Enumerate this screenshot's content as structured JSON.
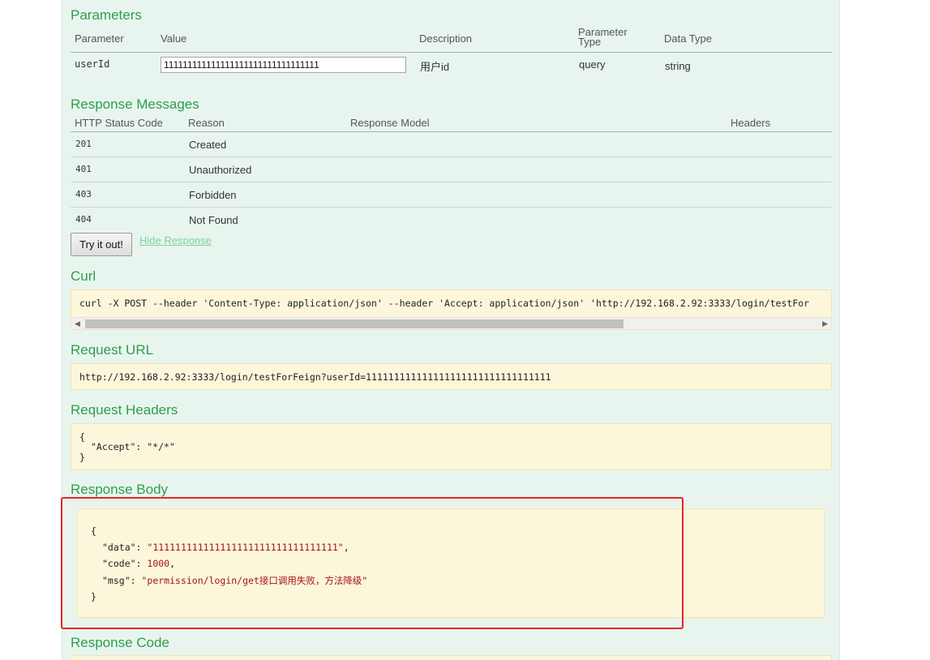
{
  "parameters": {
    "title": "Parameters",
    "headers": [
      "Parameter",
      "Value",
      "Description",
      "Parameter\nType",
      "Data Type"
    ],
    "header_type_line1": "Parameter",
    "header_type_line2": "Type",
    "row": {
      "name": "userId",
      "value": "111111111111111111111111111111111",
      "description": "用户id",
      "param_type": "query",
      "data_type": "string"
    }
  },
  "response_messages": {
    "title": "Response Messages",
    "headers": [
      "HTTP Status Code",
      "Reason",
      "Response Model",
      "Headers"
    ],
    "rows": [
      {
        "code": "201",
        "reason": "Created"
      },
      {
        "code": "401",
        "reason": "Unauthorized"
      },
      {
        "code": "403",
        "reason": "Forbidden"
      },
      {
        "code": "404",
        "reason": "Not Found"
      }
    ]
  },
  "actions": {
    "try_label": "Try it out!",
    "hide_label": "Hide Response"
  },
  "curl": {
    "title": "Curl",
    "command": "curl -X POST --header 'Content-Type: application/json' --header 'Accept: application/json' 'http://192.168.2.92:3333/login/testFor"
  },
  "request_url": {
    "title": "Request URL",
    "url": "http://192.168.2.92:3333/login/testForFeign?userId=111111111111111111111111111111111"
  },
  "request_headers": {
    "title": "Request Headers",
    "open": "{",
    "line": "\"Accept\": \"*/*\"",
    "close": "}"
  },
  "response_body": {
    "title": "Response Body",
    "open": "{",
    "data_key": "\"data\"",
    "data_val": "\"111111111111111111111111111111111\"",
    "code_key": "\"code\"",
    "code_val": "1000",
    "msg_key": "\"msg\"",
    "msg_val": "\"permission/login/get接口调用失败，方法降级\"",
    "close": "}"
  },
  "response_code": {
    "title": "Response Code"
  },
  "colors": {
    "accent": "#2d9e4f",
    "highlight": "#e0282a",
    "code_bg": "#fcf6db"
  }
}
